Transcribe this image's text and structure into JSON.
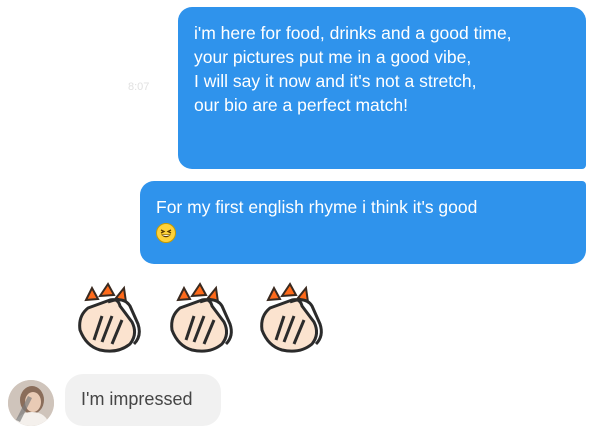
{
  "conversation": {
    "messages_sent": [
      {
        "lines": [
          "i'm here for food, drinks and a good time,",
          "your pictures put me in a good vibe,",
          "I will say it now and it's not a stretch,",
          "our bio are a perfect match!"
        ]
      },
      {
        "lines": [
          "For my first english rhyme i think it's good"
        ],
        "emoji": "grinning-squinting-face-icon"
      }
    ],
    "timestamp": "8:07",
    "reaction_emojis": [
      "clapping-hands-icon",
      "clapping-hands-icon",
      "clapping-hands-icon"
    ],
    "received_message": {
      "text": "I'm impressed"
    }
  },
  "colors": {
    "sent_bubble": "#2f93ec",
    "received_bubble": "#f1f1f1",
    "sent_text": "#ffffff",
    "received_text": "#454545"
  }
}
